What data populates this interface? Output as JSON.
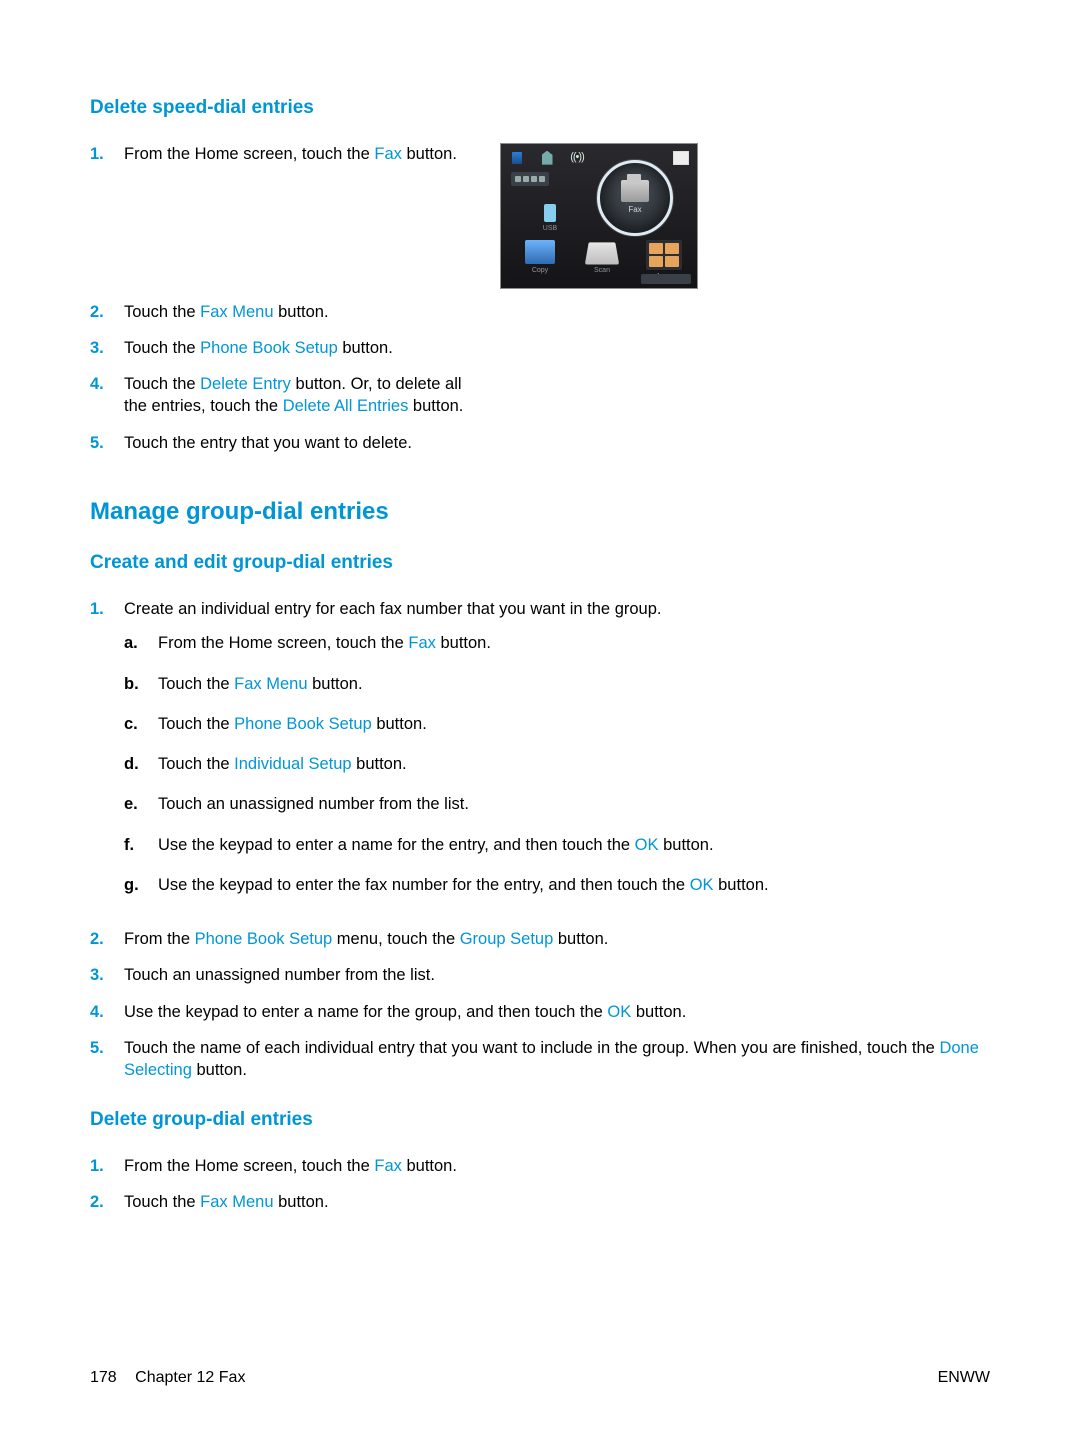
{
  "section1": {
    "heading": "Delete speed-dial entries",
    "steps": {
      "s1": {
        "num": "1.",
        "pre": "From the Home screen, touch the ",
        "link": "Fax",
        "post": " button."
      },
      "s2": {
        "num": "2.",
        "pre": "Touch the ",
        "link": "Fax Menu",
        "post": " button."
      },
      "s3": {
        "num": "3.",
        "pre": "Touch the ",
        "link": "Phone Book Setup",
        "post": " button."
      },
      "s4": {
        "num": "4.",
        "pre": "Touch the ",
        "link1": "Delete Entry",
        "mid": " button. Or, to delete all the entries, touch the ",
        "link2": "Delete All Entries",
        "post": " button."
      },
      "s5": {
        "num": "5.",
        "text": "Touch the entry that you want to delete."
      }
    }
  },
  "section2": {
    "heading": "Manage group-dial entries",
    "sub1": {
      "heading": "Create and edit group-dial entries",
      "steps": {
        "s1": {
          "num": "1.",
          "text": "Create an individual entry for each fax number that you want in the group.",
          "sub": {
            "a": {
              "m": "a.",
              "pre": "From the Home screen, touch the ",
              "link": "Fax",
              "post": " button."
            },
            "b": {
              "m": "b.",
              "pre": "Touch the ",
              "link": "Fax Menu",
              "post": " button."
            },
            "c": {
              "m": "c.",
              "pre": "Touch the ",
              "link": "Phone Book Setup",
              "post": " button."
            },
            "d": {
              "m": "d.",
              "pre": "Touch the ",
              "link": "Individual Setup",
              "post": " button."
            },
            "e": {
              "m": "e.",
              "text": "Touch an unassigned number from the list."
            },
            "f": {
              "m": "f.",
              "pre": "Use the keypad to enter a name for the entry, and then touch the ",
              "link": "OK",
              "post": " button."
            },
            "g": {
              "m": "g.",
              "pre": "Use the keypad to enter the fax number for the entry, and then touch the ",
              "link": "OK",
              "post": " button."
            }
          }
        },
        "s2": {
          "num": "2.",
          "pre": "From the ",
          "link1": "Phone Book Setup",
          "mid": " menu, touch the ",
          "link2": "Group Setup",
          "post": " button."
        },
        "s3": {
          "num": "3.",
          "text": "Touch an unassigned number from the list."
        },
        "s4": {
          "num": "4.",
          "pre": "Use the keypad to enter a name for the group, and then touch the ",
          "link": "OK",
          "post": " button."
        },
        "s5": {
          "num": "5.",
          "pre": "Touch the name of each individual entry that you want to include in the group. When you are finished, touch the ",
          "link": "Done Selecting",
          "post": " button."
        }
      }
    },
    "sub2": {
      "heading": "Delete group-dial entries",
      "steps": {
        "s1": {
          "num": "1.",
          "pre": "From the Home screen, touch the ",
          "link": "Fax",
          "post": " button."
        },
        "s2": {
          "num": "2.",
          "pre": "Touch the ",
          "link": "Fax Menu",
          "post": " button."
        }
      }
    }
  },
  "screenshot": {
    "fax": "Fax",
    "usb": "USB",
    "copy": "Copy",
    "scan": "Scan",
    "apps": "Apps"
  },
  "footer": {
    "page": "178",
    "chapter": "Chapter 12   Fax",
    "brand": "ENWW"
  }
}
